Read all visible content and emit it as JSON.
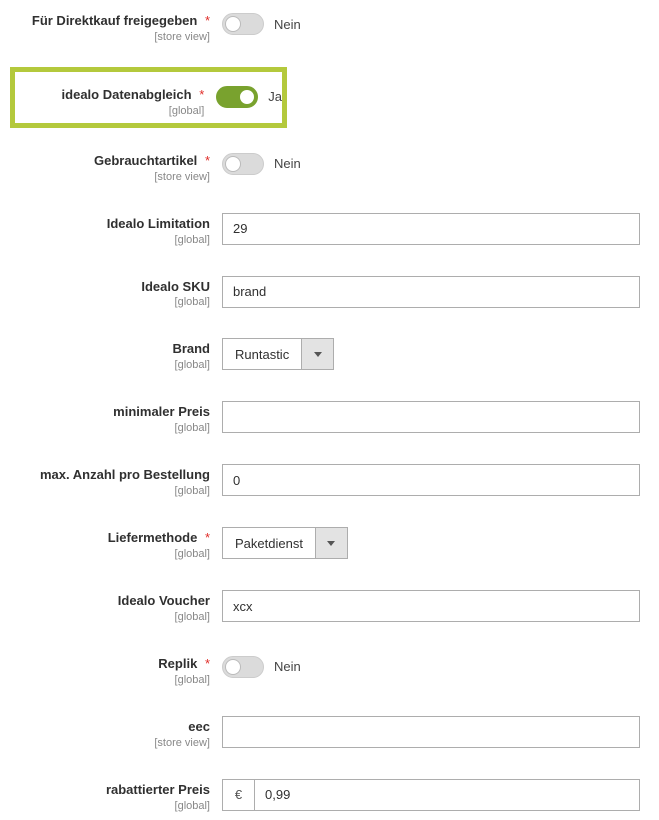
{
  "toggle_labels": {
    "yes": "Ja",
    "no": "Nein"
  },
  "fields": {
    "direktkauf": {
      "label": "Für Direktkauf freigegeben",
      "scope": "[store view]",
      "required": true,
      "value": false
    },
    "datenabgleich": {
      "label": "idealo Datenabgleich",
      "scope": "[global]",
      "required": true,
      "value": true
    },
    "gebraucht": {
      "label": "Gebrauchtartikel",
      "scope": "[store view]",
      "required": true,
      "value": false
    },
    "limitation": {
      "label": "Idealo Limitation",
      "scope": "[global]",
      "required": false,
      "value": "29"
    },
    "sku": {
      "label": "Idealo SKU",
      "scope": "[global]",
      "required": false,
      "value": "brand"
    },
    "brand": {
      "label": "Brand",
      "scope": "[global]",
      "required": false,
      "value": "Runtastic"
    },
    "minpreis": {
      "label": "minimaler Preis",
      "scope": "[global]",
      "required": false,
      "value": ""
    },
    "maxanzahl": {
      "label": "max. Anzahl pro Bestellung",
      "scope": "[global]",
      "required": false,
      "value": "0"
    },
    "liefer": {
      "label": "Liefermethode",
      "scope": "[global]",
      "required": true,
      "value": "Paketdienst"
    },
    "voucher": {
      "label": "Idealo Voucher",
      "scope": "[global]",
      "required": false,
      "value": "xcx"
    },
    "replik": {
      "label": "Replik",
      "scope": "[global]",
      "required": true,
      "value": false
    },
    "eec": {
      "label": "eec",
      "scope": "[store view]",
      "required": false,
      "value": ""
    },
    "rabatt": {
      "label": "rabattierter Preis",
      "scope": "[global]",
      "required": false,
      "value": "0,99",
      "currency": "€"
    }
  }
}
